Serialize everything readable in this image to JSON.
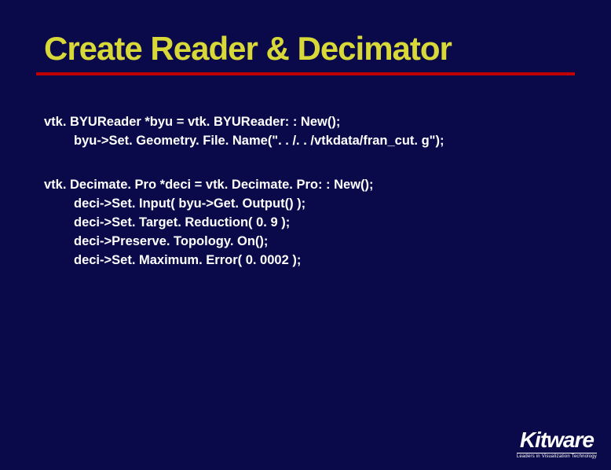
{
  "slide": {
    "title": "Create Reader & Decimator",
    "blocks": [
      {
        "lines": [
          "vtk. BYUReader *byu = vtk. BYUReader: : New();",
          "byu->Set. Geometry. File. Name(\". . /. . /vtkdata/fran_cut. g\");"
        ],
        "indent_from": 1
      },
      {
        "lines": [
          "vtk. Decimate. Pro *deci = vtk. Decimate. Pro: : New();",
          "deci->Set. Input( byu->Get. Output() );",
          "deci->Set. Target. Reduction( 0. 9 );",
          "deci->Preserve. Topology. On();",
          "deci->Set. Maximum. Error( 0. 0002 );"
        ],
        "indent_from": 1
      }
    ]
  },
  "logo": {
    "name": "Kitware",
    "tagline": "Leaders in Visualization Technology"
  }
}
